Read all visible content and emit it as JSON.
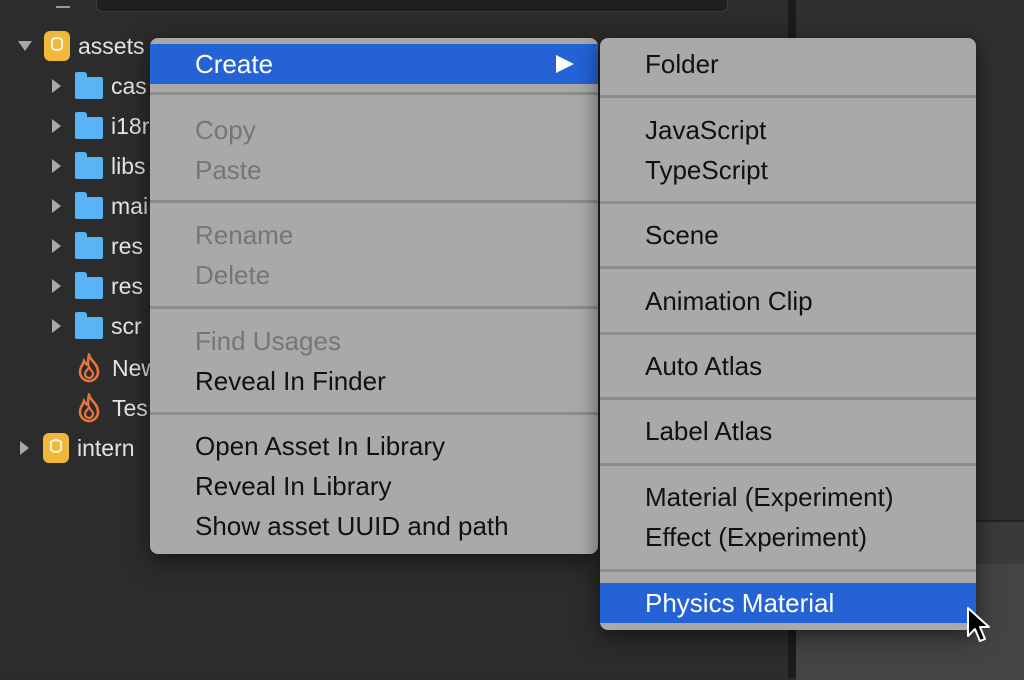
{
  "asset_tree": {
    "assets_label": "assets",
    "items": [
      {
        "label": "cas",
        "icon": "folder-icon"
      },
      {
        "label": "i18r",
        "icon": "folder-icon"
      },
      {
        "label": "libs",
        "icon": "folder-icon"
      },
      {
        "label": "mai",
        "icon": "folder-icon"
      },
      {
        "label": "res",
        "icon": "folder-icon"
      },
      {
        "label": "res",
        "icon": "folder-icon"
      },
      {
        "label": "scr",
        "icon": "folder-icon"
      },
      {
        "label": "New",
        "icon": "fire-icon"
      },
      {
        "label": "Tes",
        "icon": "fire-icon"
      }
    ],
    "internal_label": "intern"
  },
  "context_menu": {
    "create": "Create",
    "copy": "Copy",
    "paste": "Paste",
    "rename": "Rename",
    "delete": "Delete",
    "find_usages": "Find Usages",
    "reveal_in_finder": "Reveal In Finder",
    "open_asset_in_library": "Open Asset In Library",
    "reveal_in_library": "Reveal In Library",
    "show_uuid_path": "Show asset UUID and path"
  },
  "create_submenu": {
    "folder": "Folder",
    "javascript": "JavaScript",
    "typescript": "TypeScript",
    "scene": "Scene",
    "animation_clip": "Animation Clip",
    "auto_atlas": "Auto Atlas",
    "label_atlas": "Label Atlas",
    "material_experiment": "Material (Experiment)",
    "effect_experiment": "Effect (Experiment)",
    "physics_material": "Physics Material"
  },
  "colors": {
    "menu_background": "#a9a9a9",
    "highlight": "#2462d6",
    "folder": "#58b4f5",
    "database": "#f1b83c",
    "fire": "#e7743c"
  }
}
